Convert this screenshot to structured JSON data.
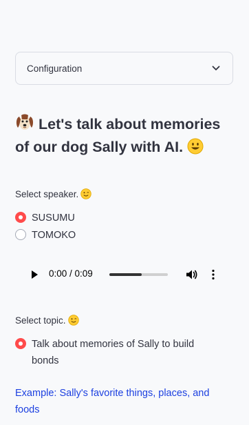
{
  "configuration": {
    "label": "Configuration"
  },
  "title": {
    "text": "Let's talk about memories of our dog Sally with AI.",
    "leading_icon": "dog-face-icon",
    "trailing_icon": "smiling-face-icon"
  },
  "speaker": {
    "label": "Select speaker.",
    "label_icon": "winking-face-icon",
    "options": [
      "SUSUMU",
      "TOMOKO"
    ],
    "selected": "SUSUMU"
  },
  "audio": {
    "time": "0:00 / 0:09",
    "progress": 0.55,
    "play_icon": "play-icon",
    "volume_icon": "volume-icon",
    "more_icon": "more-vertical-icon"
  },
  "topic": {
    "label": "Select topic.",
    "label_icon": "winking-face-icon",
    "options": [
      "Talk about memories of Sally to build bonds"
    ],
    "selected": "Talk about memories of Sally to build bonds"
  },
  "example": {
    "text": "Example: Sally's favorite things, places, and foods"
  },
  "colors": {
    "accent": "#ff4b4b",
    "link": "#1c40e0",
    "text": "#31333f",
    "background": "#f8f9fb"
  }
}
